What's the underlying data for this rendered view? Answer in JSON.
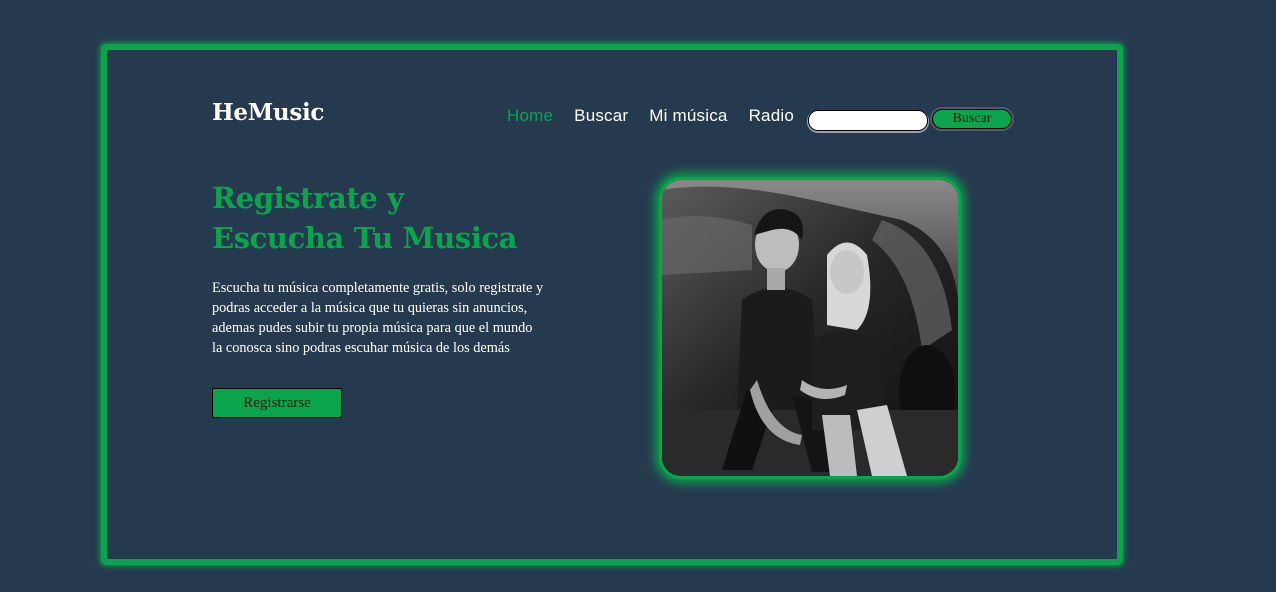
{
  "brand": {
    "logo_text": "HeMusic"
  },
  "nav": {
    "items": [
      {
        "label": "Home",
        "active": true
      },
      {
        "label": "Buscar",
        "active": false
      },
      {
        "label": "Mi música",
        "active": false
      },
      {
        "label": "Radio",
        "active": false
      }
    ],
    "search": {
      "value": "",
      "placeholder": "",
      "button_label": "Buscar"
    }
  },
  "hero": {
    "title_lines": [
      "Registrate y",
      "Escucha Tu Musica"
    ],
    "description_lines": [
      "Escucha tu música completamente gratis, solo registrate y",
      "podras acceder a la música que tu quieras sin anuncios,",
      "ademas pudes subir tu propia música para que el mundo",
      "la conosca sino podras escuhar música de los demás"
    ],
    "cta_label": "Registrarse"
  },
  "image": {
    "subject": "black-and-white photo of two young people sitting by a car"
  },
  "colors": {
    "background": "#263a4f",
    "accent": "#0aa44c",
    "text": "#ffffff"
  }
}
